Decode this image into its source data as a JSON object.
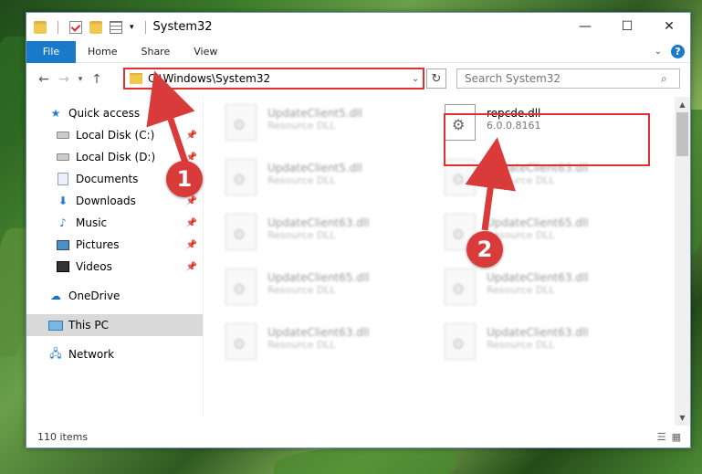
{
  "window": {
    "title": "System32"
  },
  "ribbon": {
    "tabs": [
      "File",
      "Home",
      "Share",
      "View"
    ]
  },
  "nav": {
    "address": "C:\\Windows\\System32",
    "search_placeholder": "Search System32"
  },
  "sidebar": {
    "quick_access": "Quick access",
    "items": [
      {
        "label": "Local Disk (C:)",
        "icon": "drive-icon"
      },
      {
        "label": "Local Disk (D:)",
        "icon": "drive-icon"
      },
      {
        "label": "Documents",
        "icon": "documents-icon"
      },
      {
        "label": "Downloads",
        "icon": "download-icon"
      },
      {
        "label": "Music",
        "icon": "music-icon"
      },
      {
        "label": "Pictures",
        "icon": "pictures-icon"
      },
      {
        "label": "Videos",
        "icon": "videos-icon"
      }
    ],
    "onedrive": "OneDrive",
    "this_pc": "This PC",
    "network": "Network"
  },
  "files": [
    {
      "name": "UpdateClient5.dll",
      "type": "Resource DLL"
    },
    {
      "name": "repcde.dll",
      "type": "6.0.0.8161"
    },
    {
      "name": "UpdateClient5.dll",
      "type": "Resource DLL"
    },
    {
      "name": "UpdateClient63.dll",
      "type": "Resource DLL"
    },
    {
      "name": "UpdateClient63.dll",
      "type": "Resource DLL"
    },
    {
      "name": "UpdateClient65.dll",
      "type": "Resource DLL"
    },
    {
      "name": "UpdateClient65.dll",
      "type": "Resource DLL"
    },
    {
      "name": "UpdateClient63.dll",
      "type": "Resource DLL"
    },
    {
      "name": "UpdateClient63.dll",
      "type": "Resource DLL"
    },
    {
      "name": "UpdateClient63.dll",
      "type": "Resource DLL"
    }
  ],
  "status": {
    "items": "110 items"
  },
  "annotations": {
    "step1": "1",
    "step2": "2"
  },
  "colors": {
    "accent": "#1979ca",
    "highlight": "#e03030"
  }
}
